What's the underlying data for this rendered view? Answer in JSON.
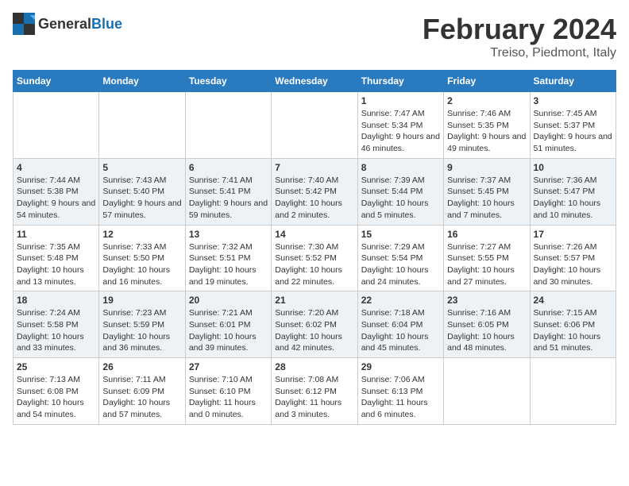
{
  "logo": {
    "text_general": "General",
    "text_blue": "Blue"
  },
  "header": {
    "month": "February 2024",
    "location": "Treiso, Piedmont, Italy"
  },
  "weekdays": [
    "Sunday",
    "Monday",
    "Tuesday",
    "Wednesday",
    "Thursday",
    "Friday",
    "Saturday"
  ],
  "weeks": [
    [
      {
        "day": "",
        "sunrise": "",
        "sunset": "",
        "daylight": ""
      },
      {
        "day": "",
        "sunrise": "",
        "sunset": "",
        "daylight": ""
      },
      {
        "day": "",
        "sunrise": "",
        "sunset": "",
        "daylight": ""
      },
      {
        "day": "",
        "sunrise": "",
        "sunset": "",
        "daylight": ""
      },
      {
        "day": "1",
        "sunrise": "Sunrise: 7:47 AM",
        "sunset": "Sunset: 5:34 PM",
        "daylight": "Daylight: 9 hours and 46 minutes."
      },
      {
        "day": "2",
        "sunrise": "Sunrise: 7:46 AM",
        "sunset": "Sunset: 5:35 PM",
        "daylight": "Daylight: 9 hours and 49 minutes."
      },
      {
        "day": "3",
        "sunrise": "Sunrise: 7:45 AM",
        "sunset": "Sunset: 5:37 PM",
        "daylight": "Daylight: 9 hours and 51 minutes."
      }
    ],
    [
      {
        "day": "4",
        "sunrise": "Sunrise: 7:44 AM",
        "sunset": "Sunset: 5:38 PM",
        "daylight": "Daylight: 9 hours and 54 minutes."
      },
      {
        "day": "5",
        "sunrise": "Sunrise: 7:43 AM",
        "sunset": "Sunset: 5:40 PM",
        "daylight": "Daylight: 9 hours and 57 minutes."
      },
      {
        "day": "6",
        "sunrise": "Sunrise: 7:41 AM",
        "sunset": "Sunset: 5:41 PM",
        "daylight": "Daylight: 9 hours and 59 minutes."
      },
      {
        "day": "7",
        "sunrise": "Sunrise: 7:40 AM",
        "sunset": "Sunset: 5:42 PM",
        "daylight": "Daylight: 10 hours and 2 minutes."
      },
      {
        "day": "8",
        "sunrise": "Sunrise: 7:39 AM",
        "sunset": "Sunset: 5:44 PM",
        "daylight": "Daylight: 10 hours and 5 minutes."
      },
      {
        "day": "9",
        "sunrise": "Sunrise: 7:37 AM",
        "sunset": "Sunset: 5:45 PM",
        "daylight": "Daylight: 10 hours and 7 minutes."
      },
      {
        "day": "10",
        "sunrise": "Sunrise: 7:36 AM",
        "sunset": "Sunset: 5:47 PM",
        "daylight": "Daylight: 10 hours and 10 minutes."
      }
    ],
    [
      {
        "day": "11",
        "sunrise": "Sunrise: 7:35 AM",
        "sunset": "Sunset: 5:48 PM",
        "daylight": "Daylight: 10 hours and 13 minutes."
      },
      {
        "day": "12",
        "sunrise": "Sunrise: 7:33 AM",
        "sunset": "Sunset: 5:50 PM",
        "daylight": "Daylight: 10 hours and 16 minutes."
      },
      {
        "day": "13",
        "sunrise": "Sunrise: 7:32 AM",
        "sunset": "Sunset: 5:51 PM",
        "daylight": "Daylight: 10 hours and 19 minutes."
      },
      {
        "day": "14",
        "sunrise": "Sunrise: 7:30 AM",
        "sunset": "Sunset: 5:52 PM",
        "daylight": "Daylight: 10 hours and 22 minutes."
      },
      {
        "day": "15",
        "sunrise": "Sunrise: 7:29 AM",
        "sunset": "Sunset: 5:54 PM",
        "daylight": "Daylight: 10 hours and 24 minutes."
      },
      {
        "day": "16",
        "sunrise": "Sunrise: 7:27 AM",
        "sunset": "Sunset: 5:55 PM",
        "daylight": "Daylight: 10 hours and 27 minutes."
      },
      {
        "day": "17",
        "sunrise": "Sunrise: 7:26 AM",
        "sunset": "Sunset: 5:57 PM",
        "daylight": "Daylight: 10 hours and 30 minutes."
      }
    ],
    [
      {
        "day": "18",
        "sunrise": "Sunrise: 7:24 AM",
        "sunset": "Sunset: 5:58 PM",
        "daylight": "Daylight: 10 hours and 33 minutes."
      },
      {
        "day": "19",
        "sunrise": "Sunrise: 7:23 AM",
        "sunset": "Sunset: 5:59 PM",
        "daylight": "Daylight: 10 hours and 36 minutes."
      },
      {
        "day": "20",
        "sunrise": "Sunrise: 7:21 AM",
        "sunset": "Sunset: 6:01 PM",
        "daylight": "Daylight: 10 hours and 39 minutes."
      },
      {
        "day": "21",
        "sunrise": "Sunrise: 7:20 AM",
        "sunset": "Sunset: 6:02 PM",
        "daylight": "Daylight: 10 hours and 42 minutes."
      },
      {
        "day": "22",
        "sunrise": "Sunrise: 7:18 AM",
        "sunset": "Sunset: 6:04 PM",
        "daylight": "Daylight: 10 hours and 45 minutes."
      },
      {
        "day": "23",
        "sunrise": "Sunrise: 7:16 AM",
        "sunset": "Sunset: 6:05 PM",
        "daylight": "Daylight: 10 hours and 48 minutes."
      },
      {
        "day": "24",
        "sunrise": "Sunrise: 7:15 AM",
        "sunset": "Sunset: 6:06 PM",
        "daylight": "Daylight: 10 hours and 51 minutes."
      }
    ],
    [
      {
        "day": "25",
        "sunrise": "Sunrise: 7:13 AM",
        "sunset": "Sunset: 6:08 PM",
        "daylight": "Daylight: 10 hours and 54 minutes."
      },
      {
        "day": "26",
        "sunrise": "Sunrise: 7:11 AM",
        "sunset": "Sunset: 6:09 PM",
        "daylight": "Daylight: 10 hours and 57 minutes."
      },
      {
        "day": "27",
        "sunrise": "Sunrise: 7:10 AM",
        "sunset": "Sunset: 6:10 PM",
        "daylight": "Daylight: 11 hours and 0 minutes."
      },
      {
        "day": "28",
        "sunrise": "Sunrise: 7:08 AM",
        "sunset": "Sunset: 6:12 PM",
        "daylight": "Daylight: 11 hours and 3 minutes."
      },
      {
        "day": "29",
        "sunrise": "Sunrise: 7:06 AM",
        "sunset": "Sunset: 6:13 PM",
        "daylight": "Daylight: 11 hours and 6 minutes."
      },
      {
        "day": "",
        "sunrise": "",
        "sunset": "",
        "daylight": ""
      },
      {
        "day": "",
        "sunrise": "",
        "sunset": "",
        "daylight": ""
      }
    ]
  ]
}
